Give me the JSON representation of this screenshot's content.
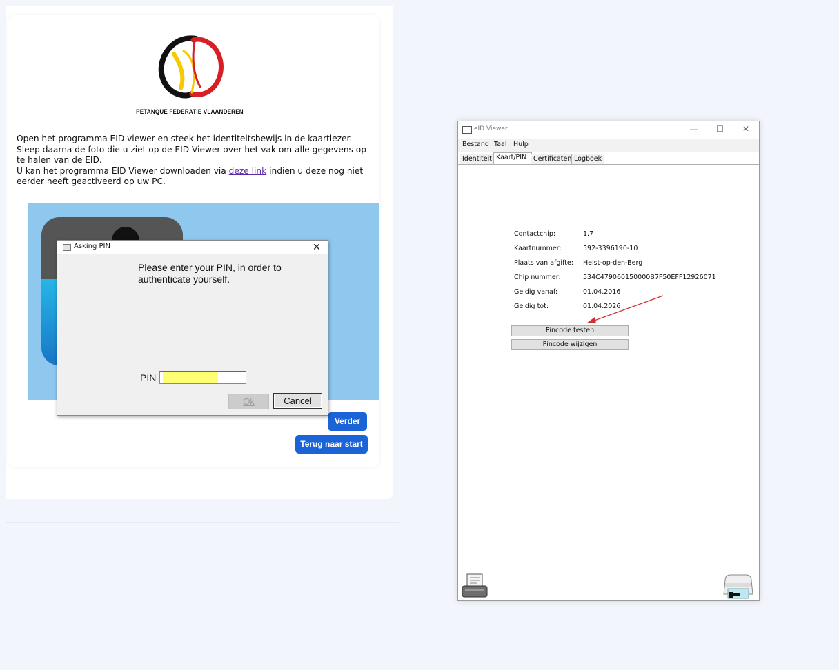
{
  "web": {
    "logo_caption": "PETANQUE FEDERATIE VLAANDEREN",
    "instructions": {
      "line1": "Open het programma EID viewer en steek het identiteitsbewijs in de kaartlezer.",
      "line2": "Sleep daarna de foto die u ziet op de EID Viewer over het vak om alle gegevens op te halen van de EID.",
      "line3_before": "U kan het programma EID Viewer downloaden via ",
      "line3_link": "deze link",
      "line3_after": " indien u deze nog niet eerder heeft geactiveerd op uw PC."
    },
    "verder_label": "Verder",
    "terug_label": "Terug naar start"
  },
  "pin_dialog": {
    "title": "Asking PIN",
    "message": "Please enter your PIN, in order to authenticate yourself.",
    "pin_label": "PIN",
    "ok_label": "Ok",
    "cancel_label": "Cancel",
    "close_glyph": "✕"
  },
  "eid_viewer": {
    "title": "eID Viewer",
    "window_controls": {
      "minimize": "—",
      "maximize": "☐",
      "close": "✕"
    },
    "menu": [
      "Bestand",
      "Taal",
      "Hulp"
    ],
    "tabs": [
      "Identiteit",
      "Kaart/PIN",
      "Certificaten",
      "Logboek"
    ],
    "active_tab": "Kaart/PIN",
    "fields": [
      {
        "label": "Contactchip:",
        "value": "1.7"
      },
      {
        "label": "Kaartnummer:",
        "value": "592-3396190-10"
      },
      {
        "label": "Plaats van afgifte:",
        "value": "Heist-op-den-Berg"
      },
      {
        "label": "Chip nummer:",
        "value": "534C479060150000B7F50EFF12926071"
      },
      {
        "label": "Geldig vanaf:",
        "value": "01.04.2016"
      },
      {
        "label": "Geldig tot:",
        "value": "01.04.2026"
      }
    ],
    "buttons": {
      "test_pin": "Pincode testen",
      "change_pin": "Pincode wijzigen"
    },
    "icons": {
      "printer": "printer-icon",
      "card_reader": "card-reader-icon"
    }
  },
  "colors": {
    "accent_blue": "#1a64d8",
    "photo_area": "#8ec8ef",
    "pin_highlight": "#ffff74",
    "annotation_arrow": "#d32f2f",
    "link": "#5b2aa6"
  }
}
